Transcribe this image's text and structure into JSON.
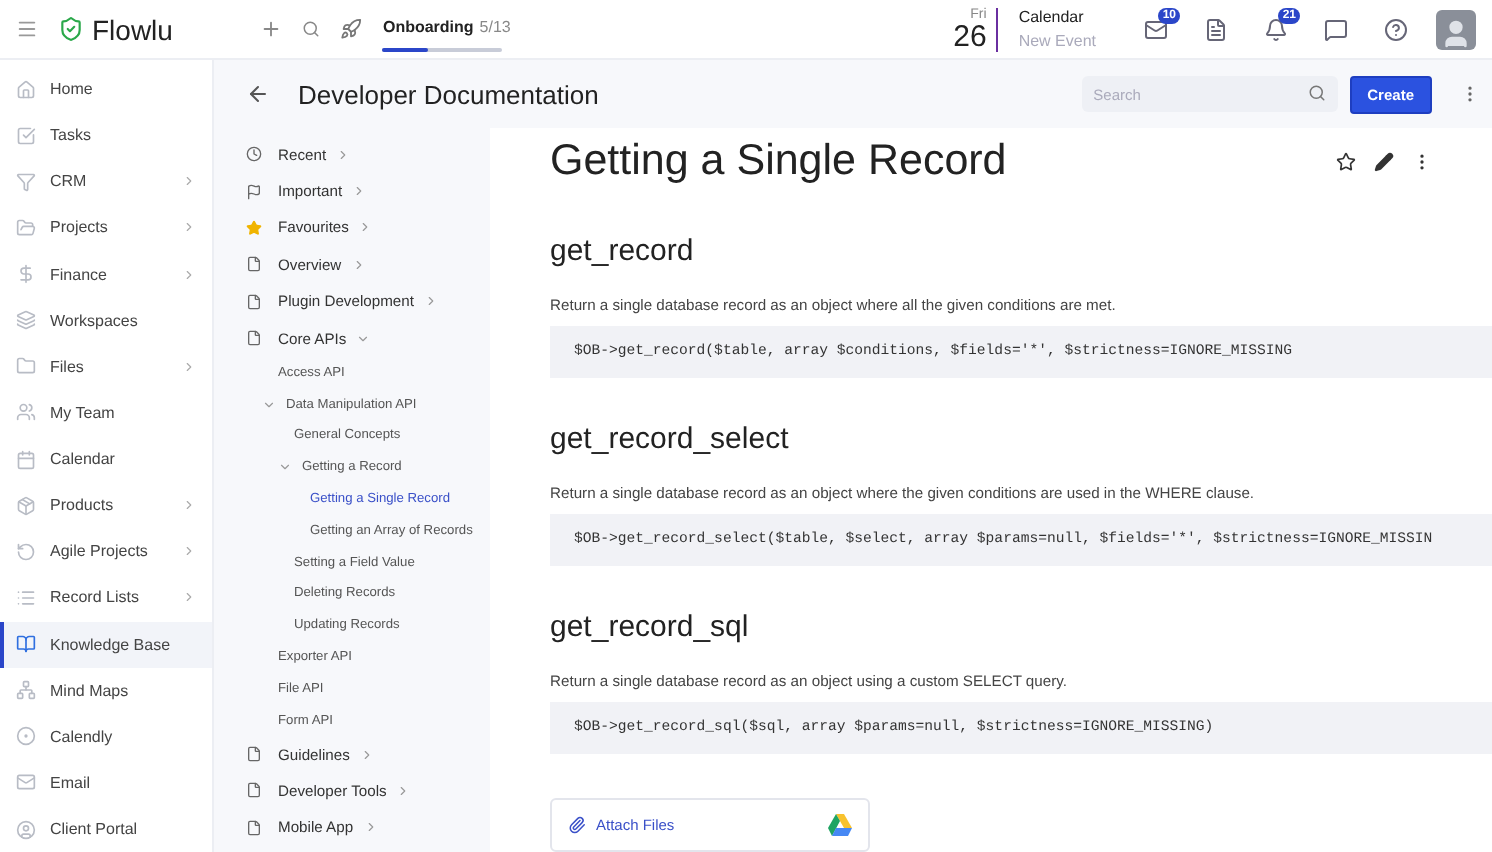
{
  "topbar": {
    "brand": "Flowlu",
    "onboarding": {
      "label": "Onboarding",
      "count": "5/13",
      "level": 0.38
    },
    "date": {
      "weekday": "Fri",
      "day": "26"
    },
    "calendar": {
      "title": "Calendar",
      "subtitle": "New Event"
    },
    "badges": [
      "10",
      "21"
    ]
  },
  "sidebar": {
    "items": [
      {
        "label": "Home",
        "submenu": false,
        "selected": false
      },
      {
        "label": "Tasks",
        "submenu": false,
        "selected": false
      },
      {
        "label": "CRM",
        "submenu": true,
        "selected": false
      },
      {
        "label": "Projects",
        "submenu": true,
        "selected": false
      },
      {
        "label": "Finance",
        "submenu": true,
        "selected": false
      },
      {
        "label": "Workspaces",
        "submenu": false,
        "selected": false
      },
      {
        "label": "Files",
        "submenu": true,
        "selected": false
      },
      {
        "label": "My Team",
        "submenu": false,
        "selected": false
      },
      {
        "label": "Calendar",
        "submenu": false,
        "selected": false
      },
      {
        "label": "Products",
        "submenu": true,
        "selected": false
      },
      {
        "label": "Agile Projects",
        "submenu": true,
        "selected": false
      },
      {
        "label": "Record Lists",
        "submenu": true,
        "selected": false
      },
      {
        "label": "Knowledge Base",
        "submenu": false,
        "selected": true
      },
      {
        "label": "Mind Maps",
        "submenu": false,
        "selected": false
      },
      {
        "label": "Calendly",
        "submenu": false,
        "selected": false
      },
      {
        "label": "Email",
        "submenu": false,
        "selected": false
      },
      {
        "label": "Client Portal",
        "submenu": false,
        "selected": false
      }
    ]
  },
  "header": {
    "title": "Developer Documentation",
    "search": {
      "placeholder": "Search"
    },
    "create_button": "Create"
  },
  "docs_nav": {
    "items": [
      {
        "label": "Recent",
        "kind": "clock",
        "expanded": false
      },
      {
        "label": "Important",
        "kind": "flag",
        "expanded": false
      },
      {
        "label": "Favourites",
        "kind": "star",
        "expanded": false
      },
      {
        "label": "Overview",
        "kind": "page",
        "expanded": false
      },
      {
        "label": "Plugin Development",
        "kind": "page",
        "expanded": false
      },
      {
        "label": "Core APIs",
        "kind": "page",
        "expanded": true,
        "children": [
          {
            "label": "Access API",
            "selected": false
          },
          {
            "label": "Data Manipulation API",
            "selected": false,
            "expanded": true,
            "children": [
              {
                "label": "General Concepts",
                "selected": false
              },
              {
                "label": "Getting a Record",
                "selected": false,
                "expanded": true,
                "children": [
                  {
                    "label": "Getting a Single Record",
                    "selected": true
                  },
                  {
                    "label": "Getting an Array of Records",
                    "selected": false
                  }
                ]
              },
              {
                "label": "Setting a Field Value",
                "selected": false
              },
              {
                "label": "Deleting Records",
                "selected": false
              },
              {
                "label": "Updating Records",
                "selected": false
              }
            ]
          },
          {
            "label": "Exporter API",
            "selected": false
          },
          {
            "label": "File API",
            "selected": false
          },
          {
            "label": "Form API",
            "selected": false
          }
        ]
      },
      {
        "label": "Guidelines",
        "kind": "page",
        "expanded": false
      },
      {
        "label": "Developer Tools",
        "kind": "page",
        "expanded": false
      },
      {
        "label": "Mobile App",
        "kind": "page",
        "expanded": false
      }
    ]
  },
  "article": {
    "title": "Getting a Single Record",
    "sections": [
      {
        "heading": "get_record",
        "text": "Return a single database record as an object where all the given conditions are met.",
        "code": "$OB->get_record($table, array $conditions, $fields='*', $strictness=IGNORE_MISSING"
      },
      {
        "heading": "get_record_select",
        "text": "Return a single database record as an object where the given conditions are used in the WHERE clause.",
        "code": "$OB->get_record_select($table, $select, array $params=null, $fields='*', $strictness=IGNORE_MISSIN"
      },
      {
        "heading": "get_record_sql",
        "text": "Return a single database record as an object using a custom SELECT query.",
        "code": "$OB->get_record_sql($sql, array $params=null, $strictness=IGNORE_MISSING)"
      }
    ],
    "attach": "Attach Files"
  }
}
